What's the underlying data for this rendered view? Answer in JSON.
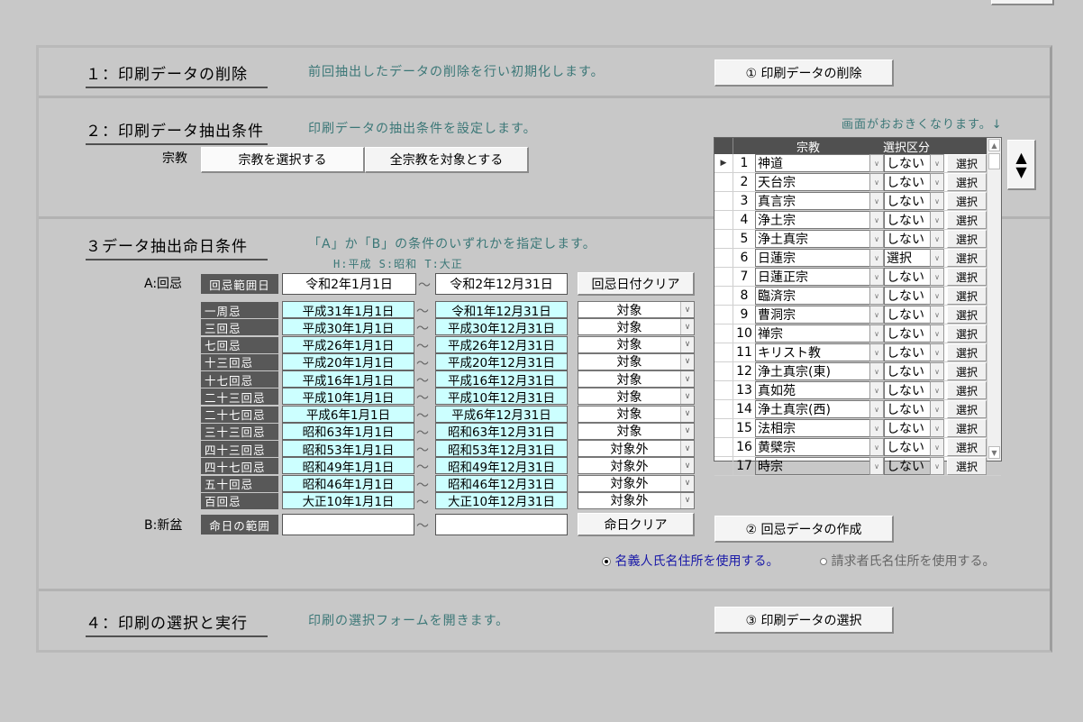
{
  "sections": {
    "s1": {
      "title": "１：印刷データの削除",
      "desc": "前回抽出したデータの削除を行い初期化します。",
      "button": "① 印刷データの削除"
    },
    "s2": {
      "title": "２：印刷データ抽出条件",
      "desc": "印刷データの抽出条件を設定します。",
      "religion_label": "宗教",
      "select_button": "宗教を選択する",
      "all_button": "全宗教を対象とする",
      "enlarge_note": "画面がおおきくなります。↓"
    },
    "s3": {
      "title": "３データ抽出命日条件",
      "desc": "「A」か「B」の条件のいずれかを指定します。",
      "era_note": "H:平成 S:昭和 T:大正",
      "a_label": "A:回忌",
      "a_tag": "回忌範囲日",
      "a_from": "令和2年1月1日",
      "a_to": "令和2年12月31日",
      "a_clear": "回忌日付クリア",
      "rows": [
        {
          "name": "一周忌",
          "from": "平成31年1月1日",
          "to": "令和1年12月31日",
          "target": "対象"
        },
        {
          "name": "三回忌",
          "from": "平成30年1月1日",
          "to": "平成30年12月31日",
          "target": "対象"
        },
        {
          "name": "七回忌",
          "from": "平成26年1月1日",
          "to": "平成26年12月31日",
          "target": "対象"
        },
        {
          "name": "十三回忌",
          "from": "平成20年1月1日",
          "to": "平成20年12月31日",
          "target": "対象"
        },
        {
          "name": "十七回忌",
          "from": "平成16年1月1日",
          "to": "平成16年12月31日",
          "target": "対象"
        },
        {
          "name": "二十三回忌",
          "from": "平成10年1月1日",
          "to": "平成10年12月31日",
          "target": "対象"
        },
        {
          "name": "二十七回忌",
          "from": "平成6年1月1日",
          "to": "平成6年12月31日",
          "target": "対象"
        },
        {
          "name": "三十三回忌",
          "from": "昭和63年1月1日",
          "to": "昭和63年12月31日",
          "target": "対象"
        },
        {
          "name": "四十三回忌",
          "from": "昭和53年1月1日",
          "to": "昭和53年12月31日",
          "target": "対象外"
        },
        {
          "name": "四十七回忌",
          "from": "昭和49年1月1日",
          "to": "昭和49年12月31日",
          "target": "対象外"
        },
        {
          "name": "五十回忌",
          "from": "昭和46年1月1日",
          "to": "昭和46年12月31日",
          "target": "対象外"
        },
        {
          "name": "百回忌",
          "from": "大正10年1月1日",
          "to": "大正10年12月31日",
          "target": "対象外"
        }
      ],
      "b_label": "B:新盆",
      "b_tag": "命日の範囲",
      "b_from": "",
      "b_to": "",
      "b_clear": "命日クリア",
      "create_button": "② 回忌データの作成",
      "radio1": "名義人氏名住所を使用する。",
      "radio2": "請求者氏名住所を使用する。"
    },
    "s4": {
      "title": "４：印刷の選択と実行",
      "desc": "印刷の選択フォームを開きます。",
      "button": "③ 印刷データの選択"
    }
  },
  "religion_list": {
    "headers": [
      "宗教",
      "選択区分"
    ],
    "pick_label": "選択",
    "rows": [
      {
        "n": "1",
        "name": "神道",
        "status": "しない"
      },
      {
        "n": "2",
        "name": "天台宗",
        "status": "しない"
      },
      {
        "n": "3",
        "name": "真言宗",
        "status": "しない"
      },
      {
        "n": "4",
        "name": "浄土宗",
        "status": "しない"
      },
      {
        "n": "5",
        "name": "浄土真宗",
        "status": "しない"
      },
      {
        "n": "6",
        "name": "日蓮宗",
        "status": "選択"
      },
      {
        "n": "7",
        "name": "日蓮正宗",
        "status": "しない"
      },
      {
        "n": "8",
        "name": "臨済宗",
        "status": "しない"
      },
      {
        "n": "9",
        "name": "曹洞宗",
        "status": "しない"
      },
      {
        "n": "10",
        "name": "禅宗",
        "status": "しない"
      },
      {
        "n": "11",
        "name": "キリスト教",
        "status": "しない"
      },
      {
        "n": "12",
        "name": "浄土真宗(東)",
        "status": "しない"
      },
      {
        "n": "13",
        "name": "真如苑",
        "status": "しない"
      },
      {
        "n": "14",
        "name": "浄土真宗(西)",
        "status": "しない"
      },
      {
        "n": "15",
        "name": "法相宗",
        "status": "しない"
      },
      {
        "n": "16",
        "name": "黄檗宗",
        "status": "しない"
      },
      {
        "n": "17",
        "name": "時宗",
        "status": "しない"
      }
    ]
  }
}
